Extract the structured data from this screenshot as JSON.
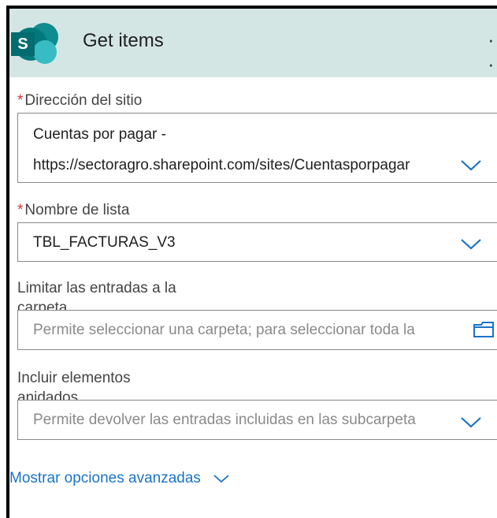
{
  "action": {
    "title": "Get items",
    "more_label": "· ·"
  },
  "fields": {
    "site": {
      "label": "Dirección del sitio",
      "required_mark": "*",
      "value_line1": "Cuentas por pagar -",
      "value_line2": "https://sectoragro.sharepoint.com/sites/Cuentasporpagar"
    },
    "list": {
      "label": "Nombre de lista",
      "required_mark": "*",
      "value": "TBL_FACTURAS_V3"
    },
    "folder": {
      "label_line1": "Limitar las entradas a la",
      "label_line2": "carpeta",
      "placeholder": "Permite seleccionar una carpeta; para seleccionar toda la"
    },
    "nested": {
      "label_line1": "Incluir elementos",
      "label_line2": "anidados",
      "placeholder": "Permite devolver las entradas incluidas en las subcarpeta"
    }
  },
  "advanced_link": "Mostrar opciones avanzadas",
  "colors": {
    "header_bg": "#d4e6e4",
    "accent_blue": "#1a73c8",
    "required_red": "#d13438",
    "sharepoint_teal": "#03787c"
  },
  "icons": [
    "sharepoint-logo-icon",
    "more-options-icon",
    "chevron-down-icon",
    "folder-icon"
  ]
}
